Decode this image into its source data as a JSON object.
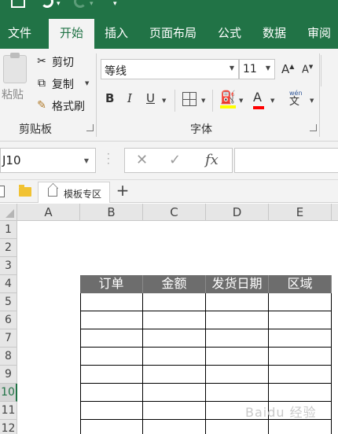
{
  "quick_access": {
    "undo_menu_glyph": "▾",
    "redo_menu_glyph": "▾",
    "customize_glyph": "▾"
  },
  "tabs": [
    {
      "label": "文件",
      "active": false
    },
    {
      "label": "开始",
      "active": true
    },
    {
      "label": "插入",
      "active": false
    },
    {
      "label": "页面布局",
      "active": false
    },
    {
      "label": "公式",
      "active": false
    },
    {
      "label": "数据",
      "active": false
    },
    {
      "label": "审阅",
      "active": false
    }
  ],
  "clipboard": {
    "paste_label": "粘贴",
    "cut_label": "剪切",
    "copy_label": "复制",
    "format_painter_label": "格式刷",
    "group_label": "剪贴板"
  },
  "font": {
    "font_name": "等线",
    "font_size": "11",
    "grow_label": "A",
    "shrink_label": "A",
    "bold_label": "B",
    "italic_label": "I",
    "underline_label": "U",
    "font_color_label": "A",
    "phonetic_label": "wén",
    "phonetic_char": "文",
    "group_label": "字体"
  },
  "formula_bar": {
    "name_box": "J10",
    "fx_label": "fx",
    "formula": ""
  },
  "doc_tabs": {
    "template_tab": "模板专区",
    "add_label": "+"
  },
  "sheet": {
    "columns": [
      "A",
      "B",
      "C",
      "D",
      "E"
    ],
    "rows": [
      "1",
      "2",
      "3",
      "4",
      "5",
      "6",
      "7",
      "8",
      "9",
      "10",
      "11",
      "12"
    ],
    "selected_row": "10",
    "table_headers": [
      "订单",
      "金额",
      "发货日期",
      "区域"
    ]
  },
  "watermark": "Baidu 经验",
  "colors": {
    "accent": "#217346",
    "table_header_bg": "#6d6d6d"
  }
}
